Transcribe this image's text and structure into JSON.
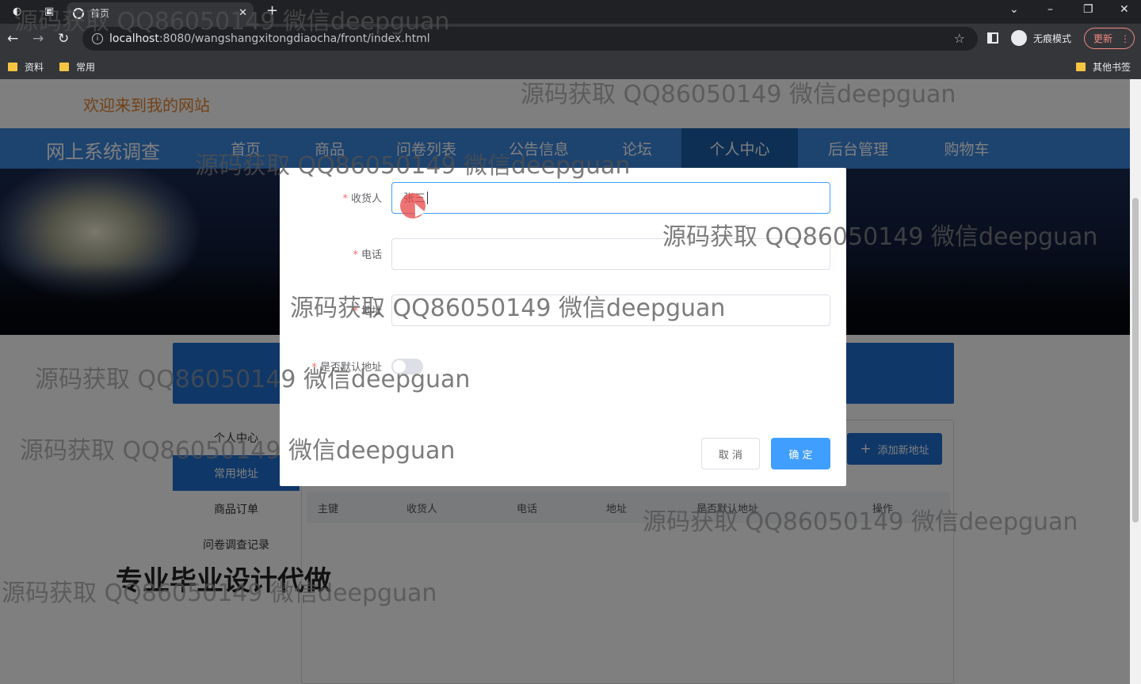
{
  "browser": {
    "tab_title": "首页",
    "url_host": "localhost",
    "url_rest": ":8080/wangshangxitongdiaocha/front/index.html",
    "incognito_label": "无痕模式",
    "update_label": "更新",
    "bookmarks": [
      "资料",
      "常用"
    ],
    "other_bookmarks": "其他书签"
  },
  "site": {
    "welcome": "欢迎来到我的网站",
    "brand": "网上系统调查",
    "nav": [
      "首页",
      "商品",
      "问卷列表",
      "公告信息",
      "论坛",
      "个人中心",
      "后台管理",
      "购物车"
    ],
    "active_nav": "个人中心"
  },
  "sidebar": {
    "items": [
      "个人中心",
      "常用地址",
      "商品订单",
      "问卷调查记录"
    ],
    "active": "常用地址"
  },
  "address_panel": {
    "add_button": "添加新地址",
    "columns": [
      "主键",
      "收货人",
      "电话",
      "地址",
      "是否默认地址",
      "操作"
    ]
  },
  "dialog": {
    "fields": [
      {
        "label": "收货人",
        "required": true,
        "value": "张三"
      },
      {
        "label": "电话",
        "required": true,
        "value": ""
      },
      {
        "label": "地址",
        "required": true,
        "value": ""
      }
    ],
    "default_label": "是否默认地址",
    "default_on": false,
    "cancel": "取 消",
    "confirm": "确 定"
  },
  "ad_text": "专业毕业设计代做",
  "watermark": "源码获取 QQ86050149 微信deepguan",
  "colors": {
    "nav": "#3a87de",
    "nav_active": "#1b5fa8",
    "primary": "#409eff",
    "welcome": "#e6822f"
  }
}
